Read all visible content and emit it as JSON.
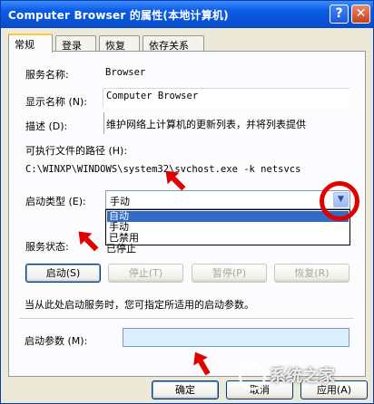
{
  "window": {
    "title": "Computer Browser 的属性(本地计算机)",
    "help_label": "?",
    "close_label": "✕"
  },
  "tabs": [
    {
      "label": "常规"
    },
    {
      "label": "登录"
    },
    {
      "label": "恢复"
    },
    {
      "label": "依存关系"
    }
  ],
  "general": {
    "service_name_label": "服务名称:",
    "service_name": "Browser",
    "display_name_label": "显示名称 (N):",
    "display_name": "Computer Browser",
    "description_label": "描述 (D):",
    "description": "维护网络上计算机的更新列表，并将列表提供",
    "exe_path_label": "可执行文件的路径 (H):",
    "exe_path": "C:\\WINXP\\WINDOWS\\system32\\svchost.exe -k netsvcs",
    "startup_type_label": "启动类型 (E):",
    "startup_type_value": "手动",
    "startup_options": [
      "自动",
      "手动",
      "已禁用"
    ],
    "status_label": "服务状态:",
    "status_value": "已停止",
    "start_btn": "启动(S)",
    "stop_btn": "停止(T)",
    "pause_btn": "暂停(P)",
    "resume_btn": "恢复(R)",
    "hint": "当从此处启动服务时，您可指定所适用的启动参数。",
    "params_label": "启动参数 (M):",
    "params_value": ""
  },
  "footer": {
    "ok": "确定",
    "cancel": "取消",
    "apply": "应用(A)"
  },
  "watermark": {
    "text": "系统之家"
  },
  "colors": {
    "annotation": "#e00000",
    "selection": "#316ac5",
    "titlebar": "#0854d9"
  }
}
